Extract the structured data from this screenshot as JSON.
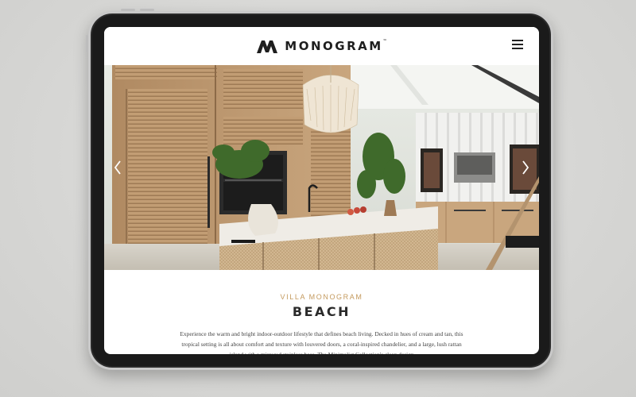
{
  "header": {
    "brand_name": "MONOGRAM",
    "brand_tm": "™"
  },
  "icons": {
    "logo": "monogram-m-logo",
    "menu": "hamburger-menu-icon",
    "prev": "chevron-left-icon",
    "next": "chevron-right-icon"
  },
  "hero": {
    "image": "kitchen-photo"
  },
  "section": {
    "eyebrow": "VILLA MONOGRAM",
    "title": "BEACH",
    "description": "Experience the warm and bright indoor-outdoor lifestyle that defines beach living. Decked in hues of cream and tan, this tropical setting is all about comfort and texture with louvered doors, a coral-inspired chandelier, and a large, lush rattan island with a mirrored stainless base. The Minimalist Collection's clean design"
  },
  "colors": {
    "accent": "#c49a5e",
    "text_dark": "#2a2a2a",
    "background": "#d9d9d7"
  }
}
